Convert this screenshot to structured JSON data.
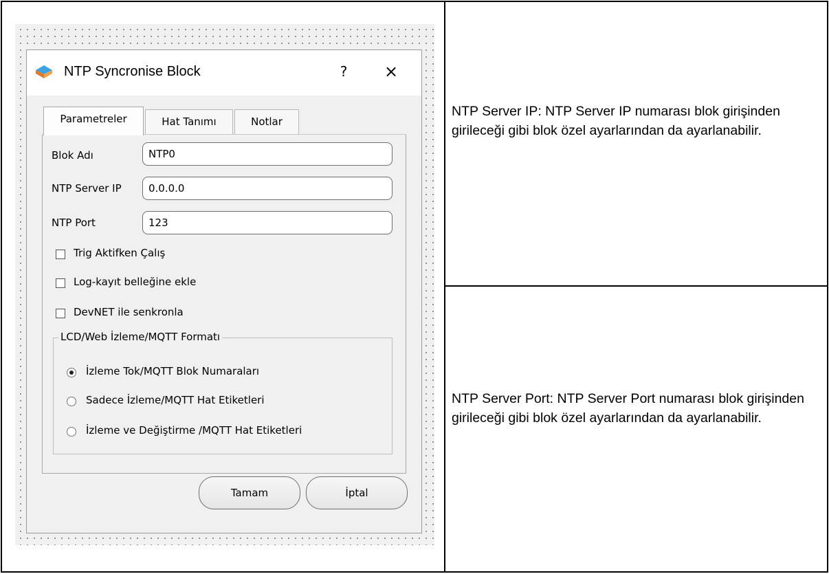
{
  "dialog": {
    "title": "NTP Syncronise Block",
    "help_label": "?",
    "close_label": "×",
    "tabs": [
      {
        "label": "Parametreler"
      },
      {
        "label": "Hat Tanımı"
      },
      {
        "label": "Notlar"
      }
    ],
    "fields": [
      {
        "label": "Blok Adı",
        "value": "NTP0"
      },
      {
        "label": "NTP Server IP",
        "value": "0.0.0.0"
      },
      {
        "label": "NTP Port",
        "value": "123"
      }
    ],
    "checkboxes": [
      {
        "label": "Trig Aktifken Çalış",
        "checked": false
      },
      {
        "label": "Log-kayıt belleğine ekle",
        "checked": false
      },
      {
        "label": "DevNET ile senkronla",
        "checked": false
      }
    ],
    "group": {
      "title": "LCD/Web İzleme/MQTT Formatı",
      "options": [
        {
          "label": "İzleme Tok/MQTT Blok Numaraları",
          "selected": true
        },
        {
          "label": "Sadece İzleme/MQTT Hat Etiketleri",
          "selected": false
        },
        {
          "label": "İzleme ve Değiştirme /MQTT Hat Etiketleri",
          "selected": false
        }
      ]
    },
    "ok_label": "Tamam",
    "cancel_label": "İptal"
  },
  "descriptions": [
    {
      "text": "NTP Server IP: NTP Server IP numarası blok girişinden girileceği gibi blok özel ayarlarından da ayarlanabilir."
    },
    {
      "text": "NTP Server Port: NTP Server Port numarası blok girişinden girileceği gibi blok özel ayarlarından da ayarlanabilir."
    }
  ],
  "colors": {
    "border": "#000000",
    "dialog_bg": "#f0f0f0",
    "canvas_dot": "#8a8a8a"
  }
}
